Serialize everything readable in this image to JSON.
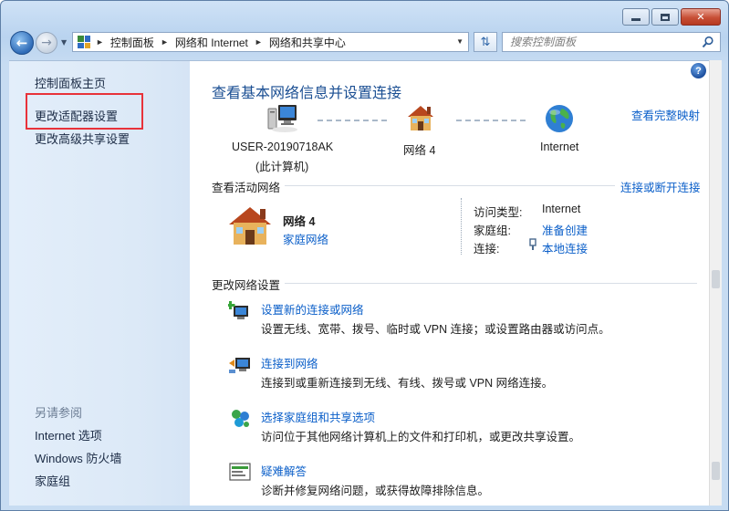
{
  "window": {
    "title_controls": {
      "minimize": "minimize",
      "maximize": "maximize",
      "close": "✕"
    }
  },
  "navigation": {
    "breadcrumbs": [
      "控制面板",
      "网络和 Internet",
      "网络和共享中心"
    ],
    "search_placeholder": "搜索控制面板"
  },
  "sidebar": {
    "links": [
      {
        "label": "控制面板主页"
      },
      {
        "label": "更改适配器设置"
      },
      {
        "label": "更改高级共享设置"
      }
    ],
    "see_also_header": "另请参阅",
    "see_also": [
      {
        "label": "Internet 选项"
      },
      {
        "label": "Windows 防火墙"
      },
      {
        "label": "家庭组"
      }
    ]
  },
  "main": {
    "title": "查看基本网络信息并设置连接",
    "view_full_map": "查看完整映射",
    "map": {
      "computer_name": "USER-20190718AK",
      "computer_sub": "(此计算机)",
      "network_name": "网络  4",
      "internet": "Internet"
    },
    "active_networks": {
      "header": "查看活动网络",
      "connect_disconnect": "连接或断开连接",
      "network_name": "网络  4",
      "network_type": "家庭网络",
      "access_type_label": "访问类型:",
      "access_type_value": "Internet",
      "homegroup_label": "家庭组:",
      "homegroup_value": "准备创建",
      "connections_label": "连接:",
      "connections_value": "本地连接"
    },
    "change_settings": {
      "header": "更改网络设置",
      "tasks": [
        {
          "title": "设置新的连接或网络",
          "desc": "设置无线、宽带、拨号、临时或 VPN 连接；或设置路由器或访问点。",
          "icon": "new-connection-icon"
        },
        {
          "title": "连接到网络",
          "desc": "连接到或重新连接到无线、有线、拨号或 VPN 网络连接。",
          "icon": "connect-network-icon"
        },
        {
          "title": "选择家庭组和共享选项",
          "desc": "访问位于其他网络计算机上的文件和打印机，或更改共享设置。",
          "icon": "homegroup-icon"
        },
        {
          "title": "疑难解答",
          "desc": "诊断并修复网络问题，或获得故障排除信息。",
          "icon": "troubleshoot-icon"
        }
      ]
    }
  },
  "colors": {
    "link": "#0b5fc9",
    "title": "#1b4f93",
    "highlight": "#e8323a"
  }
}
